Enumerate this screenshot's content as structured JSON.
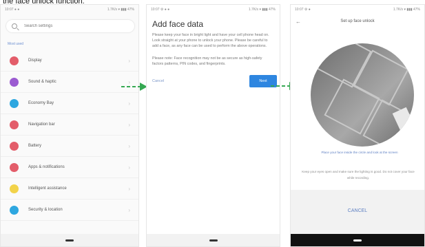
{
  "caption": "the face unlock function.",
  "phone1": {
    "status_left": "10:07 ● ●",
    "status_right": "1.7K/s ▾ ▮▮▮ 47%",
    "search_placeholder": "Search settings",
    "section_label": "Most used",
    "items": [
      {
        "label": "Display",
        "color": "#e35d6a"
      },
      {
        "label": "Sound & haptic",
        "color": "#9b5bd1"
      },
      {
        "label": "Economy Bay",
        "color": "#2ea7e0"
      },
      {
        "label": "Navigation bar",
        "color": "#e35d6a"
      },
      {
        "label": "Battery",
        "color": "#e35d6a"
      },
      {
        "label": "Apps & notifications",
        "color": "#e35d6a"
      },
      {
        "label": "Intelligent assistance",
        "color": "#f2d34a"
      },
      {
        "label": "Security & location",
        "color": "#2ea7e0"
      }
    ]
  },
  "phone2": {
    "status_left": "10:07 ⚙ ● ●",
    "status_right": "1.7K/s ▾ ▮▮▮ 47%",
    "title": "Add face data",
    "para1": "Please keep your face in bright light and have your cell phone head on. Look straight at your phone to unlock your phone. Please be careful to add a face, as any face can be used to perform the above operations.",
    "para2": "Please note: Face recognition may not be as secure as high-safety factors patterns, PIN codes, and fingerprints.",
    "cancel": "Cancel",
    "next": "Next"
  },
  "phone3": {
    "status_left": "10:07 ⚙ ●",
    "status_right": "1.7K/s ▾ ▮▮▮ 47%",
    "title": "Set up face unlock",
    "hint_blue": "Place your face inside the circle and look at the screen",
    "hint_gray": "Keep your eyes open and make sure the lighting is good. Do not cover your face while recording.",
    "cancel": "CANCEL"
  }
}
